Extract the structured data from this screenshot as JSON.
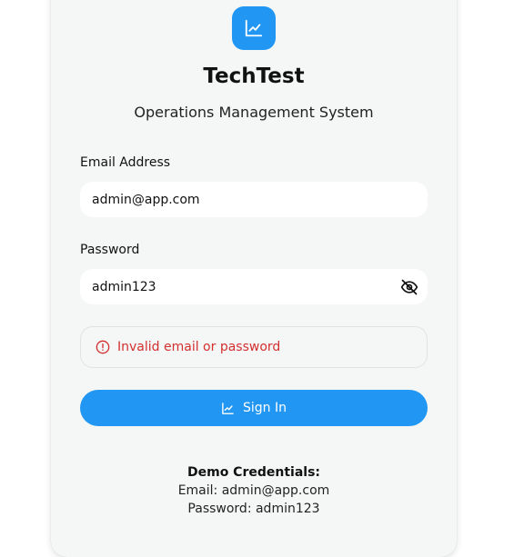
{
  "app": {
    "logo_icon": "line-chart-icon",
    "title": "TechTest",
    "subtitle": "Operations Management System"
  },
  "form": {
    "email_label": "Email Address",
    "email_value": "admin@app.com",
    "password_label": "Password",
    "password_value": "admin123",
    "password_toggle_icon": "eye-off-icon",
    "error_icon": "alert-circle-icon",
    "error_message": "Invalid email or password",
    "submit_icon": "line-chart-icon",
    "submit_label": "Sign In"
  },
  "demo": {
    "heading": "Demo Credentials:",
    "email_line": "Email: admin@app.com",
    "password_line": "Password: admin123"
  },
  "colors": {
    "accent": "#2196f3",
    "error": "#d32f2f",
    "card_bg": "#f5f7f7"
  }
}
